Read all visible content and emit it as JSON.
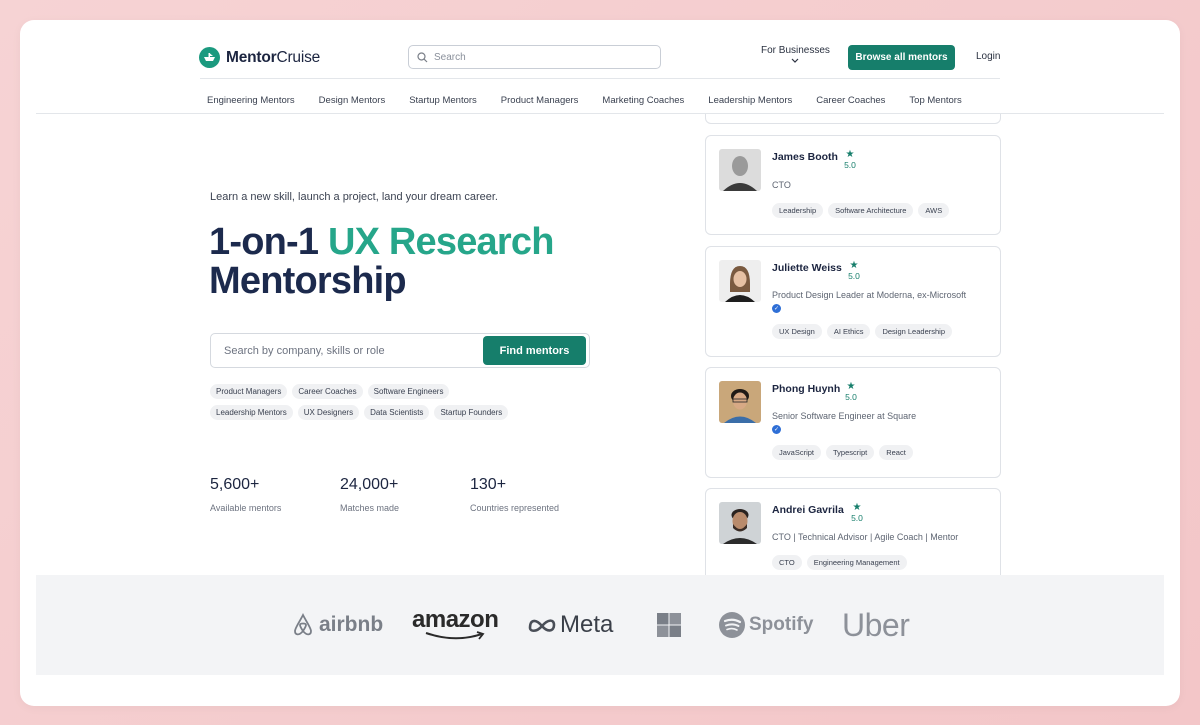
{
  "brand": {
    "name_bold": "Mentor",
    "name_rest": "Cruise"
  },
  "header": {
    "search_placeholder": "Search",
    "for_businesses": "For Businesses",
    "browse_button": "Browse all mentors",
    "login": "Login"
  },
  "categories": [
    "Engineering Mentors",
    "Design Mentors",
    "Startup Mentors",
    "Product Managers",
    "Marketing Coaches",
    "Leadership Mentors",
    "Career Coaches",
    "Top Mentors"
  ],
  "hero": {
    "tagline": "Learn a new skill, launch a project, land your dream career.",
    "headline_prefix": "1-on-1 ",
    "headline_accent": "UX Research",
    "headline_suffix": "Mentorship",
    "search_placeholder": "Search by company, skills or role",
    "find_button": "Find mentors",
    "chips_row1": [
      "Product Managers",
      "Career Coaches",
      "Software Engineers"
    ],
    "chips_row2": [
      "Leadership Mentors",
      "UX Designers",
      "Data Scientists",
      "Startup Founders"
    ]
  },
  "stats": [
    {
      "value": "5,600+",
      "label": "Available mentors"
    },
    {
      "value": "24,000+",
      "label": "Matches made"
    },
    {
      "value": "130+",
      "label": "Countries represented"
    }
  ],
  "mentors": [
    {
      "name": "James Booth",
      "rating": "5.0",
      "role": "CTO",
      "verified": false,
      "tags": [
        "Leadership",
        "Software Architecture",
        "AWS"
      ]
    },
    {
      "name": "Juliette Weiss",
      "rating": "5.0",
      "role": "Product Design Leader at Moderna, ex-Microsoft",
      "verified": true,
      "tags": [
        "UX Design",
        "AI Ethics",
        "Design Leadership"
      ]
    },
    {
      "name": "Phong Huynh",
      "rating": "5.0",
      "role": "Senior Software Engineer at Square",
      "verified": true,
      "tags": [
        "JavaScript",
        "Typescript",
        "React"
      ]
    },
    {
      "name": "Andrei Gavrila",
      "rating": "5.0",
      "role": "CTO | Technical Advisor | Agile Coach | Mentor",
      "verified": false,
      "tags": [
        "CTO",
        "Engineering Management"
      ]
    }
  ],
  "company_logos": {
    "airbnb": "airbnb",
    "amazon": "amazon",
    "meta": "Meta",
    "spotify": "Spotify",
    "uber": "Uber"
  },
  "colors": {
    "accent": "#167e6b",
    "headline": "#1c2a4d",
    "headline_accent": "#26a68a"
  }
}
